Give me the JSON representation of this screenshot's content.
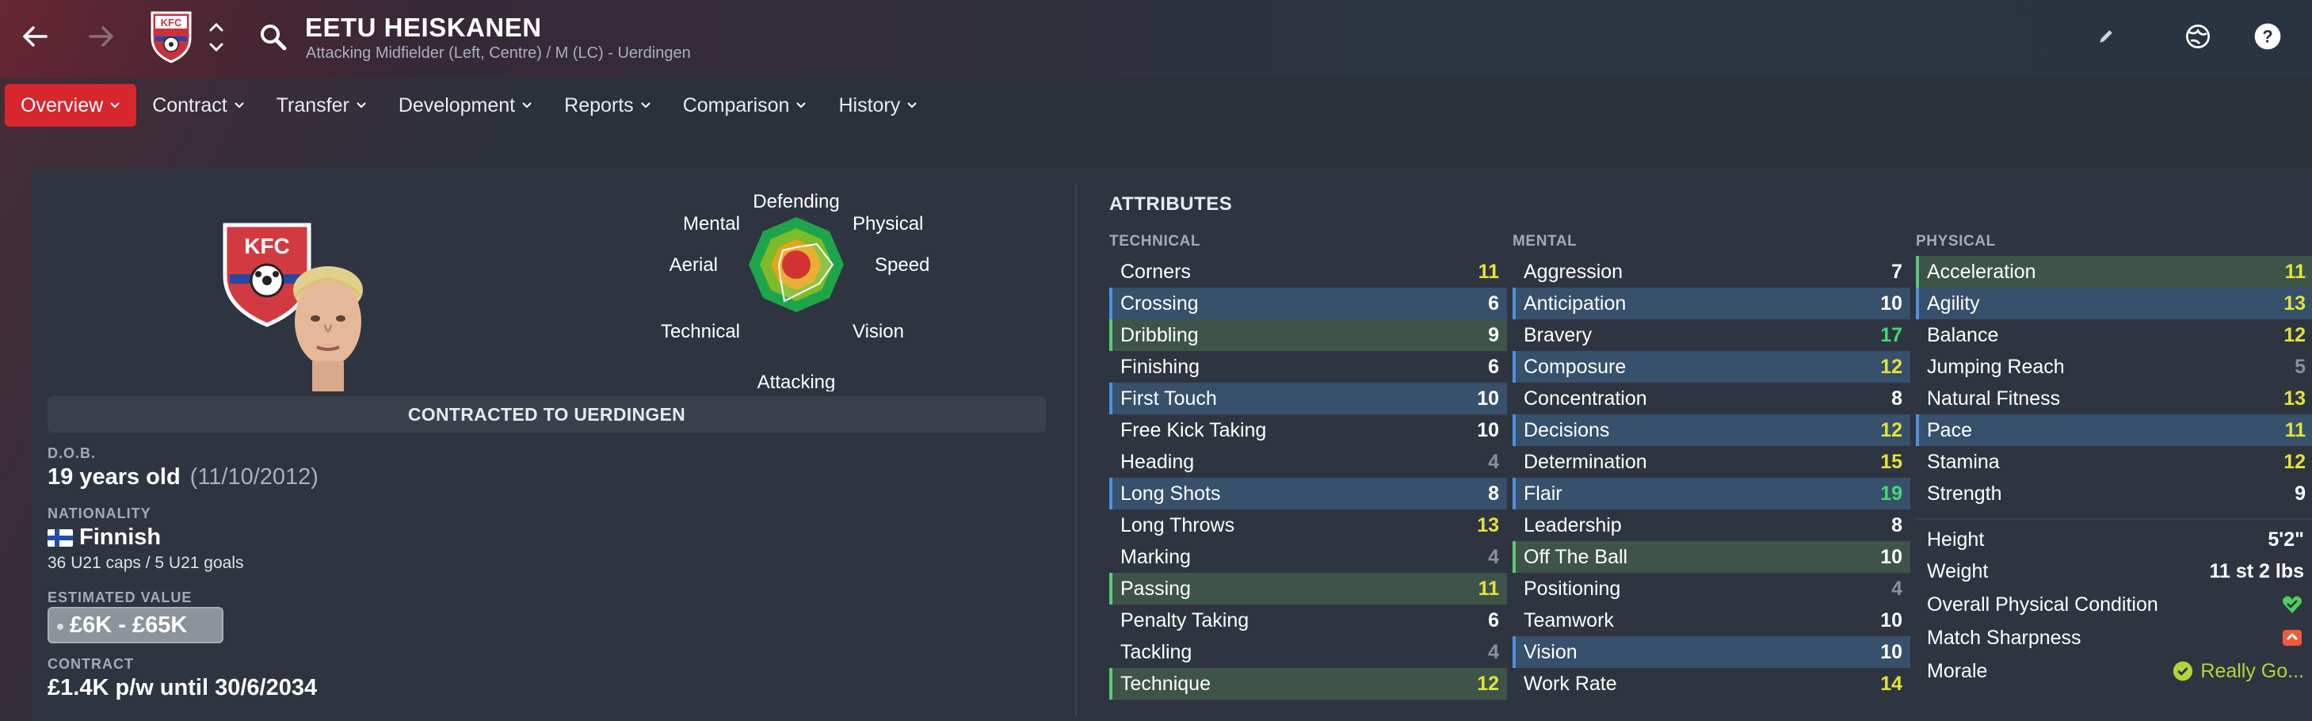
{
  "header": {
    "player_name": "EETU HEISKANEN",
    "player_sub": "Attacking Midfielder (Left, Centre) / M (LC) - Uerdingen",
    "club_badge_text": "KFC"
  },
  "tabs": [
    {
      "label": "Overview",
      "active": true
    },
    {
      "label": "Contract"
    },
    {
      "label": "Transfer"
    },
    {
      "label": "Development"
    },
    {
      "label": "Reports"
    },
    {
      "label": "Comparison"
    },
    {
      "label": "History"
    }
  ],
  "radar": {
    "labels": [
      "Defending",
      "Physical",
      "Speed",
      "Vision",
      "Attacking",
      "Technical",
      "Aerial",
      "Mental"
    ]
  },
  "profile": {
    "contracted_text": "CONTRACTED TO UERDINGEN",
    "dob_label": "D.O.B.",
    "dob_age": "19 years old",
    "dob_date": "(11/10/2012)",
    "nationality_label": "NATIONALITY",
    "nationality": "Finnish",
    "caps": "36 U21 caps / 5 U21 goals",
    "value_label": "ESTIMATED VALUE",
    "value": "£6K - £65K",
    "contract_label": "CONTRACT",
    "contract": "£1.4K p/w until 30/6/2034"
  },
  "attributes": {
    "title": "ATTRIBUTES",
    "technical_title": "TECHNICAL",
    "mental_title": "MENTAL",
    "physical_title": "PHYSICAL",
    "technical": [
      {
        "name": "Corners",
        "value": "11",
        "color": "yellow",
        "hl": ""
      },
      {
        "name": "Crossing",
        "value": "6",
        "color": "white",
        "hl": "blue"
      },
      {
        "name": "Dribbling",
        "value": "9",
        "color": "white",
        "hl": "green"
      },
      {
        "name": "Finishing",
        "value": "6",
        "color": "white",
        "hl": ""
      },
      {
        "name": "First Touch",
        "value": "10",
        "color": "white",
        "hl": "blue"
      },
      {
        "name": "Free Kick Taking",
        "value": "10",
        "color": "white",
        "hl": ""
      },
      {
        "name": "Heading",
        "value": "4",
        "color": "grey",
        "hl": ""
      },
      {
        "name": "Long Shots",
        "value": "8",
        "color": "white",
        "hl": "blue"
      },
      {
        "name": "Long Throws",
        "value": "13",
        "color": "yellow",
        "hl": ""
      },
      {
        "name": "Marking",
        "value": "4",
        "color": "grey",
        "hl": ""
      },
      {
        "name": "Passing",
        "value": "11",
        "color": "yellow",
        "hl": "green"
      },
      {
        "name": "Penalty Taking",
        "value": "6",
        "color": "white",
        "hl": ""
      },
      {
        "name": "Tackling",
        "value": "4",
        "color": "grey",
        "hl": ""
      },
      {
        "name": "Technique",
        "value": "12",
        "color": "yellow",
        "hl": "green"
      }
    ],
    "mental": [
      {
        "name": "Aggression",
        "value": "7",
        "color": "white",
        "hl": ""
      },
      {
        "name": "Anticipation",
        "value": "10",
        "color": "white",
        "hl": "blue"
      },
      {
        "name": "Bravery",
        "value": "17",
        "color": "green",
        "hl": ""
      },
      {
        "name": "Composure",
        "value": "12",
        "color": "yellow",
        "hl": "blue"
      },
      {
        "name": "Concentration",
        "value": "8",
        "color": "white",
        "hl": ""
      },
      {
        "name": "Decisions",
        "value": "12",
        "color": "yellow",
        "hl": "blue"
      },
      {
        "name": "Determination",
        "value": "15",
        "color": "yellow",
        "hl": ""
      },
      {
        "name": "Flair",
        "value": "19",
        "color": "green",
        "hl": "blue"
      },
      {
        "name": "Leadership",
        "value": "8",
        "color": "white",
        "hl": ""
      },
      {
        "name": "Off The Ball",
        "value": "10",
        "color": "white",
        "hl": "green"
      },
      {
        "name": "Positioning",
        "value": "4",
        "color": "grey",
        "hl": ""
      },
      {
        "name": "Teamwork",
        "value": "10",
        "color": "white",
        "hl": ""
      },
      {
        "name": "Vision",
        "value": "10",
        "color": "white",
        "hl": "blue"
      },
      {
        "name": "Work Rate",
        "value": "14",
        "color": "yellow",
        "hl": ""
      }
    ],
    "physical": [
      {
        "name": "Acceleration",
        "value": "11",
        "color": "yellow",
        "hl": "green"
      },
      {
        "name": "Agility",
        "value": "13",
        "color": "yellow",
        "hl": "blue"
      },
      {
        "name": "Balance",
        "value": "12",
        "color": "yellow",
        "hl": ""
      },
      {
        "name": "Jumping Reach",
        "value": "5",
        "color": "grey",
        "hl": ""
      },
      {
        "name": "Natural Fitness",
        "value": "13",
        "color": "yellow",
        "hl": ""
      },
      {
        "name": "Pace",
        "value": "11",
        "color": "yellow",
        "hl": "blue"
      },
      {
        "name": "Stamina",
        "value": "12",
        "color": "yellow",
        "hl": ""
      },
      {
        "name": "Strength",
        "value": "9",
        "color": "white",
        "hl": ""
      }
    ],
    "physical_extra": {
      "height_label": "Height",
      "height": "5'2\"",
      "weight_label": "Weight",
      "weight": "11 st 2 lbs",
      "condition_label": "Overall Physical Condition",
      "sharpness_label": "Match Sharpness",
      "morale_label": "Morale",
      "morale": "Really Go..."
    }
  }
}
